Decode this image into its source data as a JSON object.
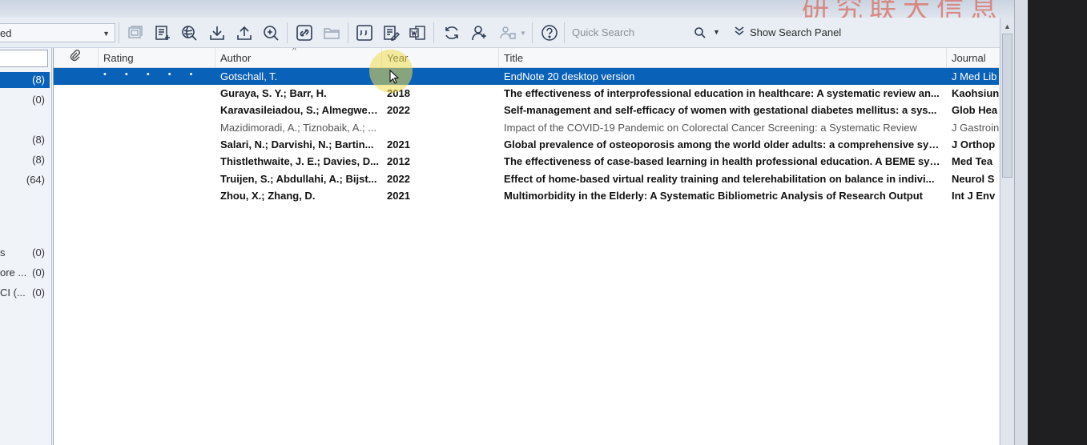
{
  "toolbar": {
    "group_select_value": "ed",
    "quick_search_placeholder": "Quick Search",
    "show_search_panel_label": "Show Search Panel",
    "icons": [
      "new-group-icon",
      "new-reference-icon",
      "online-search-icon",
      "import-icon",
      "export-icon",
      "find-full-text-icon",
      "open-link-icon",
      "open-folder-icon",
      "insert-citation-icon",
      "format-bibliography-icon",
      "word-icon",
      "sync-icon",
      "share-icon",
      "manage-sharing-icon",
      "help-icon"
    ]
  },
  "watermark_text": "研究联大信息",
  "sidebar": {
    "rows": [
      {
        "label": "",
        "count": "(8)",
        "selected": true
      },
      {
        "label": "",
        "count": "(0)"
      },
      {
        "label": "",
        "count": "(8)"
      },
      {
        "label": "",
        "count": "(8)"
      },
      {
        "label": "",
        "count": "(64)"
      },
      {
        "label": "s",
        "count": "(0)"
      },
      {
        "label": "ore ...",
        "count": "(0)"
      },
      {
        "label": "CI (...",
        "count": "(0)"
      }
    ]
  },
  "columns": {
    "rating": "Rating",
    "author": "Author",
    "year": "Year",
    "title": "Title",
    "journal": "Journal"
  },
  "references": [
    {
      "rating": "• • • • •",
      "author": "Gotschall, T.",
      "year": "",
      "title": "EndNote 20 desktop version",
      "journal": "J Med Lib",
      "state": "selected"
    },
    {
      "rating": "",
      "author": "Guraya, S. Y.; Barr, H.",
      "year": "2018",
      "title": "The effectiveness of interprofessional education in healthcare: A systematic review an...",
      "journal": "Kaohsiun",
      "state": "unread"
    },
    {
      "rating": "",
      "author": "Karavasileiadou, S.; Almegwel...",
      "year": "2022",
      "title": "Self-management and self-efficacy of women with gestational diabetes mellitus: a sys...",
      "journal": "Glob Hea",
      "state": "unread"
    },
    {
      "rating": "",
      "author": "Mazidimoradi, A.; Tiznobaik, A.; ...",
      "year": "",
      "title": "Impact of the COVID-19 Pandemic on Colorectal Cancer Screening: a Systematic Review",
      "journal": "J Gastroin",
      "state": "read"
    },
    {
      "rating": "",
      "author": "Salari, N.; Darvishi, N.; Bartin...",
      "year": "2021",
      "title": "Global prevalence of osteoporosis among the world older adults: a comprehensive sys...",
      "journal": "J Orthop",
      "state": "unread"
    },
    {
      "rating": "",
      "author": "Thistlethwaite, J. E.; Davies, D...",
      "year": "2012",
      "title": "The effectiveness of case-based learning in health professional education. A BEME sys...",
      "journal": "Med Tea",
      "state": "unread"
    },
    {
      "rating": "",
      "author": "Truijen, S.; Abdullahi, A.; Bijst...",
      "year": "2022",
      "title": "Effect of home-based virtual reality training and telerehabilitation on balance in indivi...",
      "journal": "Neurol S",
      "state": "unread"
    },
    {
      "rating": "",
      "author": "Zhou, X.; Zhang, D.",
      "year": "2021",
      "title": "Multimorbidity in the Elderly: A Systematic Bibliometric Analysis of Research Output",
      "journal": "Int J Env",
      "state": "unread"
    }
  ]
}
